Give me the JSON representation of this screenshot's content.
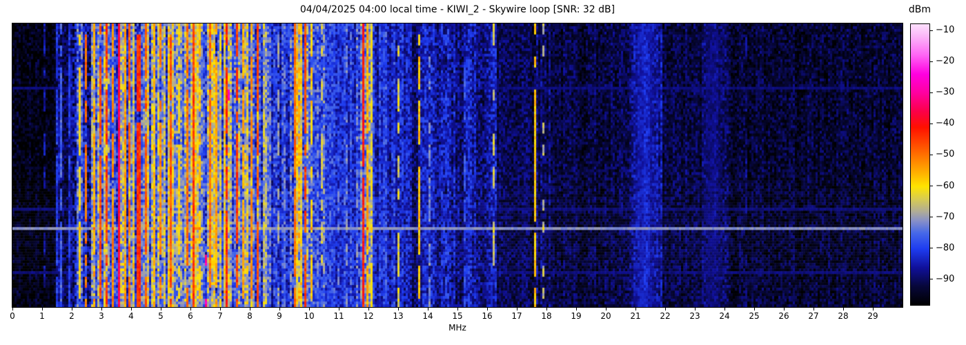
{
  "title": "04/04/2025 04:00 local time - KIWI_2 - Skywire loop [SNR: 32 dB]",
  "chart_data": {
    "type": "heatmap",
    "subtype": "radio-spectrum-waterfall",
    "title": "04/04/2025 04:00 local time - KIWI_2 - Skywire loop [SNR: 32 dB]",
    "xlabel": "MHz",
    "x_range_mhz": [
      0,
      30
    ],
    "x_ticks": [
      "0",
      "1",
      "2",
      "3",
      "4",
      "5",
      "6",
      "7",
      "8",
      "9",
      "10",
      "11",
      "12",
      "13",
      "14",
      "15",
      "16",
      "17",
      "18",
      "19",
      "20",
      "21",
      "22",
      "23",
      "24",
      "25",
      "26",
      "27",
      "28",
      "29"
    ],
    "y_axis": "time (no labels shown)",
    "colorbar": {
      "label": "dBm",
      "range_dbm": [
        -98,
        -8
      ],
      "tick_values": [
        -10,
        -20,
        -30,
        -40,
        -50,
        -60,
        -70,
        -80,
        -90
      ],
      "tick_labels": [
        "−10",
        "−20",
        "−30",
        "−40",
        "−50",
        "−60",
        "−70",
        "−80",
        "−90"
      ]
    },
    "colormap_stops": [
      [
        -98,
        "#000000"
      ],
      [
        -92,
        "#07073a"
      ],
      [
        -86,
        "#10109a"
      ],
      [
        -80,
        "#1e3cf0"
      ],
      [
        -75,
        "#4668e8"
      ],
      [
        -71,
        "#8890c8"
      ],
      [
        -68,
        "#b0ac96"
      ],
      [
        -64,
        "#d8cc50"
      ],
      [
        -60,
        "#ffe400"
      ],
      [
        -56,
        "#ffb400"
      ],
      [
        -51,
        "#ff7d00"
      ],
      [
        -46,
        "#ff4500"
      ],
      [
        -41,
        "#ff1000"
      ],
      [
        -36,
        "#fb0048"
      ],
      [
        -30,
        "#ff00a0"
      ],
      [
        -24,
        "#ff00e0"
      ],
      [
        -18,
        "#ff64f5"
      ],
      [
        -12,
        "#fbb5f8"
      ],
      [
        -8,
        "#fde0fd"
      ]
    ],
    "grid": {
      "cols": 430,
      "rows": 103,
      "seed": 42
    },
    "noise_regions": [
      {
        "f0": 0.0,
        "f1": 1.45,
        "base": -96,
        "jit": 5,
        "cj": 2
      },
      {
        "f0": 1.45,
        "f1": 2.05,
        "base": -87,
        "jit": 6,
        "cj": 5
      },
      {
        "f0": 2.05,
        "f1": 2.62,
        "base": -81,
        "jit": 8,
        "cj": 8
      },
      {
        "f0": 2.62,
        "f1": 8.55,
        "base": -72,
        "jit": 8,
        "cj": 11
      },
      {
        "f0": 8.55,
        "f1": 9.35,
        "base": -80,
        "jit": 7,
        "cj": 6
      },
      {
        "f0": 9.35,
        "f1": 10.15,
        "base": -71,
        "jit": 8,
        "cj": 10
      },
      {
        "f0": 10.15,
        "f1": 10.6,
        "base": -78,
        "jit": 7,
        "cj": 6
      },
      {
        "f0": 10.6,
        "f1": 11.6,
        "base": -80,
        "jit": 6,
        "cj": 5
      },
      {
        "f0": 11.6,
        "f1": 12.15,
        "base": -73,
        "jit": 8,
        "cj": 8
      },
      {
        "f0": 12.15,
        "f1": 13.15,
        "base": -83,
        "jit": 6,
        "cj": 5
      },
      {
        "f0": 13.15,
        "f1": 16.3,
        "base": -86,
        "jit": 6,
        "cj": 4
      },
      {
        "f0": 16.3,
        "f1": 18.3,
        "base": -90,
        "jit": 5,
        "cj": 3
      },
      {
        "f0": 18.3,
        "f1": 20.8,
        "base": -92,
        "jit": 5,
        "cj": 2
      },
      {
        "f0": 20.8,
        "f1": 21.9,
        "base": -87,
        "jit": 5,
        "cj": 3
      },
      {
        "f0": 21.9,
        "f1": 23.2,
        "base": -92,
        "jit": 5,
        "cj": 2
      },
      {
        "f0": 23.2,
        "f1": 24.2,
        "base": -90,
        "jit": 5,
        "cj": 2
      },
      {
        "f0": 24.2,
        "f1": 30.0,
        "base": -93,
        "jit": 5,
        "cj": 2
      }
    ],
    "signal_stripes": [
      {
        "f": 1.05,
        "w": 0.03,
        "l": -86,
        "d": 0.5
      },
      {
        "f": 1.5,
        "w": 0.04,
        "l": -80,
        "d": 0.7
      },
      {
        "f": 1.62,
        "w": 0.04,
        "l": -76,
        "d": 0.8
      },
      {
        "f": 1.9,
        "w": 0.03,
        "l": -80,
        "d": 0.6
      },
      {
        "f": 2.3,
        "w": 0.05,
        "l": -60,
        "d": 0.7
      },
      {
        "f": 2.5,
        "w": 0.05,
        "l": -50,
        "d": 0.75
      },
      {
        "f": 2.78,
        "w": 0.05,
        "l": -55,
        "d": 0.8
      },
      {
        "f": 2.95,
        "w": 0.09,
        "l": -47,
        "d": 0.9
      },
      {
        "f": 3.2,
        "w": 0.06,
        "l": -45,
        "d": 0.9
      },
      {
        "f": 3.35,
        "w": 0.04,
        "l": -52,
        "d": 0.8
      },
      {
        "f": 3.58,
        "w": 0.04,
        "l": -36,
        "d": 1.0
      },
      {
        "f": 3.78,
        "w": 0.05,
        "l": -54,
        "d": 0.8
      },
      {
        "f": 3.95,
        "w": 0.07,
        "l": -49,
        "d": 0.85
      },
      {
        "f": 4.25,
        "w": 0.1,
        "l": -44,
        "d": 0.95
      },
      {
        "f": 4.5,
        "w": 0.05,
        "l": -48,
        "d": 0.85
      },
      {
        "f": 4.75,
        "w": 0.05,
        "l": -57,
        "d": 0.8
      },
      {
        "f": 5.0,
        "w": 0.06,
        "l": -52,
        "d": 0.8
      },
      {
        "f": 5.35,
        "w": 0.08,
        "l": -47,
        "d": 0.85
      },
      {
        "f": 5.62,
        "w": 0.04,
        "l": -60,
        "d": 0.7
      },
      {
        "f": 5.88,
        "w": 0.05,
        "l": -50,
        "d": 0.75
      },
      {
        "f": 6.1,
        "w": 0.06,
        "l": -45,
        "d": 0.9
      },
      {
        "f": 6.3,
        "w": 0.04,
        "l": -57,
        "d": 0.7
      },
      {
        "f": 6.5,
        "w": 0.03,
        "l": -29,
        "d": 0.1
      },
      {
        "f": 6.65,
        "w": 0.07,
        "l": -50,
        "d": 0.85
      },
      {
        "f": 6.9,
        "w": 0.05,
        "l": -55,
        "d": 0.8
      },
      {
        "f": 7.2,
        "w": 0.06,
        "l": -43,
        "d": 0.9
      },
      {
        "f": 7.3,
        "w": 0.03,
        "l": -30,
        "d": 0.12
      },
      {
        "f": 7.55,
        "w": 0.05,
        "l": -45,
        "d": 0.85
      },
      {
        "f": 7.8,
        "w": 0.05,
        "l": -55,
        "d": 0.8
      },
      {
        "f": 8.05,
        "w": 0.06,
        "l": -52,
        "d": 0.8
      },
      {
        "f": 8.3,
        "w": 0.05,
        "l": -47,
        "d": 0.85
      },
      {
        "f": 8.95,
        "w": 0.04,
        "l": -70,
        "d": 0.6
      },
      {
        "f": 9.15,
        "w": 0.04,
        "l": -74,
        "d": 0.5
      },
      {
        "f": 9.5,
        "w": 0.05,
        "l": -50,
        "d": 0.8
      },
      {
        "f": 9.68,
        "w": 0.04,
        "l": -56,
        "d": 0.7
      },
      {
        "f": 9.9,
        "w": 0.05,
        "l": -46,
        "d": 0.8
      },
      {
        "f": 10.08,
        "w": 0.04,
        "l": -58,
        "d": 0.7
      },
      {
        "f": 10.45,
        "w": 0.04,
        "l": -65,
        "d": 0.5
      },
      {
        "f": 11.0,
        "w": 0.03,
        "l": -75,
        "d": 0.4
      },
      {
        "f": 11.25,
        "w": 0.03,
        "l": -73,
        "d": 0.4
      },
      {
        "f": 11.8,
        "w": 0.06,
        "l": -42,
        "d": 0.95
      },
      {
        "f": 11.95,
        "w": 0.05,
        "l": -55,
        "d": 0.8
      },
      {
        "f": 12.1,
        "w": 0.04,
        "l": -62,
        "d": 0.6
      },
      {
        "f": 13.0,
        "w": 0.03,
        "l": -63,
        "d": 0.5
      },
      {
        "f": 13.7,
        "w": 0.03,
        "l": -58,
        "d": 0.75
      },
      {
        "f": 14.05,
        "w": 0.03,
        "l": -72,
        "d": 0.5
      },
      {
        "f": 14.6,
        "w": 0.03,
        "l": -80,
        "d": 0.4
      },
      {
        "f": 15.0,
        "w": 0.03,
        "l": -64,
        "d": 0.4
      },
      {
        "f": 15.25,
        "w": 0.03,
        "l": -78,
        "d": 0.4
      },
      {
        "f": 16.2,
        "w": 0.03,
        "l": -65,
        "d": 0.35
      },
      {
        "f": 17.6,
        "w": 0.04,
        "l": -58,
        "d": 0.8
      },
      {
        "f": 17.9,
        "w": 0.03,
        "l": -67,
        "d": 0.4
      },
      {
        "f": 21.3,
        "w": 0.7,
        "l": -84,
        "d": 1.0,
        "soft": true
      },
      {
        "f": 23.6,
        "w": 0.7,
        "l": -88,
        "d": 1.0,
        "soft": true
      },
      {
        "f": 24.75,
        "w": 0.06,
        "l": -88,
        "d": 0.6
      }
    ],
    "horizontal_artifacts": [
      {
        "y_frac": 0.72,
        "min_level_dbm": -76,
        "boost_db": 5
      },
      {
        "y_frac": 0.22,
        "min_level_dbm": -88,
        "boost_db": 0
      },
      {
        "y_frac": 0.65,
        "min_level_dbm": -88,
        "boost_db": 0
      },
      {
        "y_frac": 0.87,
        "min_level_dbm": -88,
        "boost_db": 0
      }
    ],
    "legend_position": "colorbar-right",
    "grid_lines": false
  }
}
